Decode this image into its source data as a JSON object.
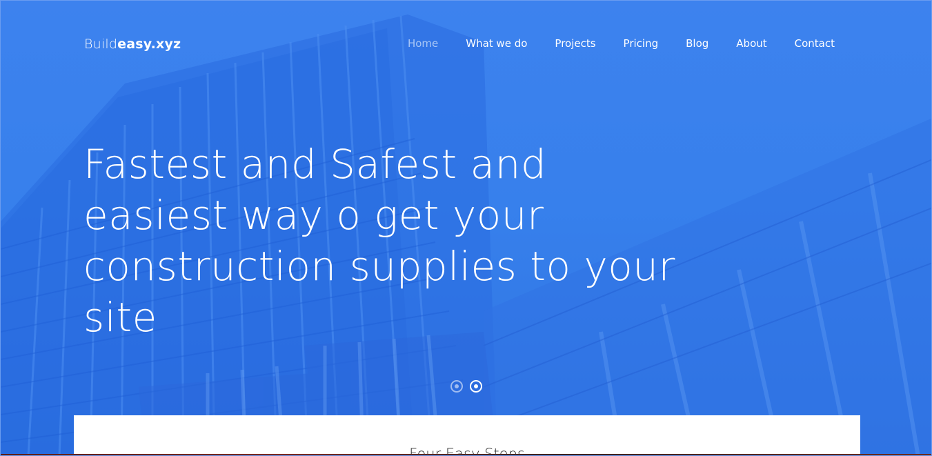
{
  "brand": {
    "prefix": "Build",
    "emphasis": "easy.xyz"
  },
  "nav": {
    "items": [
      {
        "label": "Home",
        "active": true
      },
      {
        "label": "What we do"
      },
      {
        "label": "Projects"
      },
      {
        "label": "Pricing"
      },
      {
        "label": "Blog"
      },
      {
        "label": "About"
      },
      {
        "label": "Contact"
      }
    ]
  },
  "hero": {
    "lines": [
      "Fastest and Safest and",
      "easiest way o get your",
      "construction supplies to your",
      "site"
    ],
    "slides": {
      "count": 2,
      "active": 2
    }
  },
  "section": {
    "title": "Four Easy Steps"
  },
  "colors": {
    "primary": "#3a80ec",
    "nav_active": "#a9c7f6",
    "text": "#ffffff"
  }
}
